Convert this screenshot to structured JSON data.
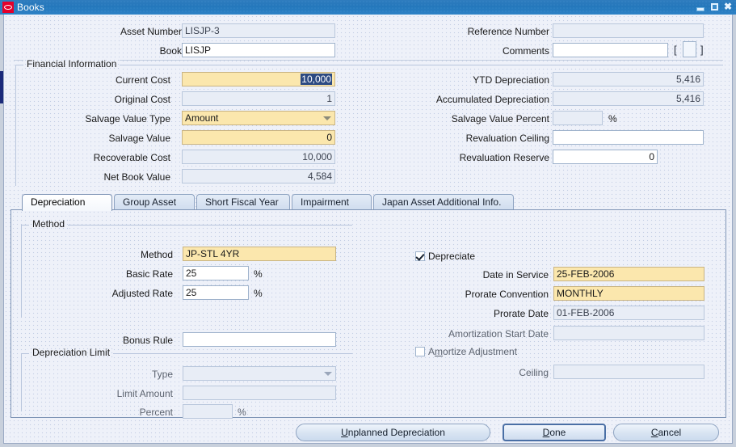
{
  "window": {
    "title": "Books",
    "logo_icon": "oracle-logo-icon",
    "controls": [
      {
        "name": "minimize-button",
        "icon": "minimize-icon",
        "glyph": "_"
      },
      {
        "name": "maximize-button",
        "icon": "maximize-icon",
        "glyph": "□"
      },
      {
        "name": "close-button",
        "icon": "close-icon",
        "glyph": "✖"
      }
    ]
  },
  "header": {
    "asset_number_label": "Asset Number",
    "asset_number_value": "LISJP-3",
    "book_label": "Book",
    "book_value": "LISJP",
    "reference_number_label": "Reference Number",
    "reference_number_value": "",
    "comments_label": "Comments",
    "comments_value": "",
    "flex_open_bracket": "[",
    "flex_close_bracket": "]"
  },
  "financial": {
    "group_title": "Financial Information",
    "current_cost_label": "Current Cost",
    "current_cost_value": "10,000",
    "original_cost_label": "Original Cost",
    "original_cost_value": "1",
    "salvage_value_type_label": "Salvage Value Type",
    "salvage_value_type_value": "Amount",
    "salvage_value_label": "Salvage Value",
    "salvage_value_value": "0",
    "recoverable_cost_label": "Recoverable Cost",
    "recoverable_cost_value": "10,000",
    "net_book_value_label": "Net Book Value",
    "net_book_value_value": "4,584",
    "ytd_depreciation_label": "YTD Depreciation",
    "ytd_depreciation_value": "5,416",
    "accumulated_depreciation_label": "Accumulated Depreciation",
    "accumulated_depreciation_value": "5,416",
    "salvage_value_percent_label": "Salvage Value Percent",
    "salvage_value_percent_value": "",
    "salvage_value_percent_unit": "%",
    "revaluation_ceiling_label": "Revaluation Ceiling",
    "revaluation_ceiling_value": "",
    "revaluation_reserve_label": "Revaluation Reserve",
    "revaluation_reserve_value": "0"
  },
  "tabs": [
    {
      "label": "Depreciation",
      "active": true
    },
    {
      "label": "Group Asset",
      "active": false
    },
    {
      "label": "Short Fiscal Year",
      "active": false
    },
    {
      "label": "Impairment",
      "active": false
    },
    {
      "label": "Japan Asset Additional Info.",
      "active": false
    }
  ],
  "depreciation_tab": {
    "method_group_title": "Method",
    "method_label": "Method",
    "method_value": "JP-STL 4YR",
    "basic_rate_label": "Basic Rate",
    "basic_rate_value": "25",
    "basic_rate_unit": "%",
    "adjusted_rate_label": "Adjusted Rate",
    "adjusted_rate_value": "25",
    "adjusted_rate_unit": "%",
    "bonus_rule_label": "Bonus Rule",
    "bonus_rule_value": "",
    "depreciation_limit_group_title": "Depreciation Limit",
    "type_label": "Type",
    "type_value": "",
    "limit_amount_label": "Limit Amount",
    "limit_amount_value": "",
    "percent_label": "Percent",
    "percent_value": "",
    "percent_unit": "%",
    "depreciate_checkbox_label": "Depreciate",
    "depreciate_checked": true,
    "date_in_service_label": "Date in Service",
    "date_in_service_value": "25-FEB-2006",
    "prorate_convention_label": "Prorate Convention",
    "prorate_convention_value": "MONTHLY",
    "prorate_date_label": "Prorate Date",
    "prorate_date_value": "01-FEB-2006",
    "amortization_start_date_label": "Amortization Start Date",
    "amortization_start_date_value": "",
    "amortize_adjustment_label_pre": "A",
    "amortize_adjustment_label_mn": "m",
    "amortize_adjustment_label_post": "ortize Adjustment",
    "amortize_adjustment_checked": false,
    "ceiling_label": "Ceiling",
    "ceiling_value": ""
  },
  "buttons": {
    "unplanned_mn": "U",
    "unplanned_rest": "nplanned Depreciation",
    "done_mn": "D",
    "done_rest": "one",
    "cancel_mn": "C",
    "cancel_rest": "ancel"
  },
  "colors": {
    "titlebar": "#2477bb",
    "canvas": "#eef1f9",
    "required_field": "#fbe7ad",
    "readonly_field": "#e8edf6",
    "selection": "#2c4a82"
  }
}
